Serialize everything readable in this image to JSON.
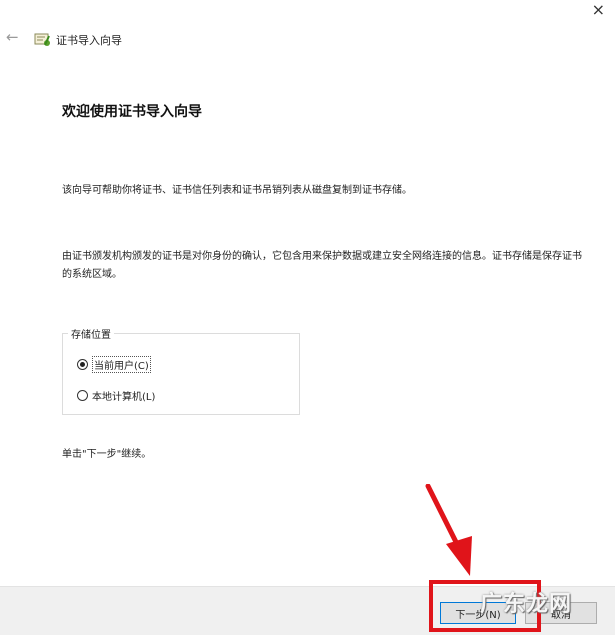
{
  "window": {
    "close_glyph": "×",
    "back_glyph": "←",
    "title": "证书导入向导"
  },
  "content": {
    "heading": "欢迎使用证书导入向导",
    "paragraph1": "该向导可帮助你将证书、证书信任列表和证书吊销列表从磁盘复制到证书存储。",
    "paragraph2": "由证书颁发机构颁发的证书是对你身份的确认，它包含用来保护数据或建立安全网络连接的信息。证书存储是保存证书的系统区域。",
    "store_location": {
      "legend": "存储位置",
      "options": [
        {
          "label": "当前用户(C)",
          "checked": true
        },
        {
          "label": "本地计算机(L)",
          "checked": false
        }
      ]
    },
    "hint": "单击\"下一步\"继续。"
  },
  "footer": {
    "next_label": "下一步(N)",
    "cancel_label": "取消"
  },
  "watermark": "广东龙网",
  "colors": {
    "highlight": "#e0141a",
    "arrow": "#e0141a"
  }
}
